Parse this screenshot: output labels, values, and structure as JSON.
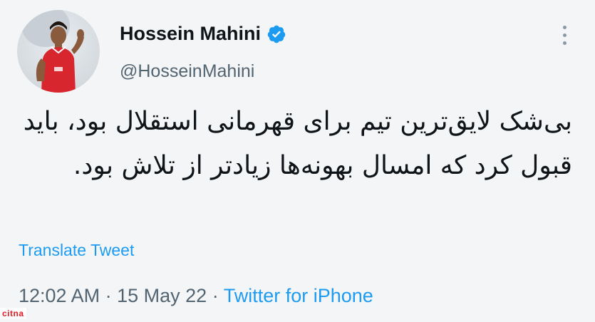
{
  "tweet": {
    "author_name": "Hossein Mahini",
    "handle": "@HosseinMahini",
    "text": "بی‌شک لایق‌ترین تیم برای قهرمانی استقلال بود، باید قبول کرد که امسال بهونه‌ها زیادتر از تلاش بود.",
    "translate_label": "Translate Tweet",
    "time": "12:02 AM",
    "separator": "·",
    "date": "15 May 22",
    "source": "Twitter for iPhone"
  },
  "icons": {
    "verified": "verified-badge-icon",
    "more": "more-options-icon",
    "avatar": "profile-avatar"
  },
  "colors": {
    "accent": "#1d9bf0",
    "text": "#0f1419",
    "secondary": "#536471",
    "watermark": "#e31b23"
  },
  "watermark": "citna"
}
